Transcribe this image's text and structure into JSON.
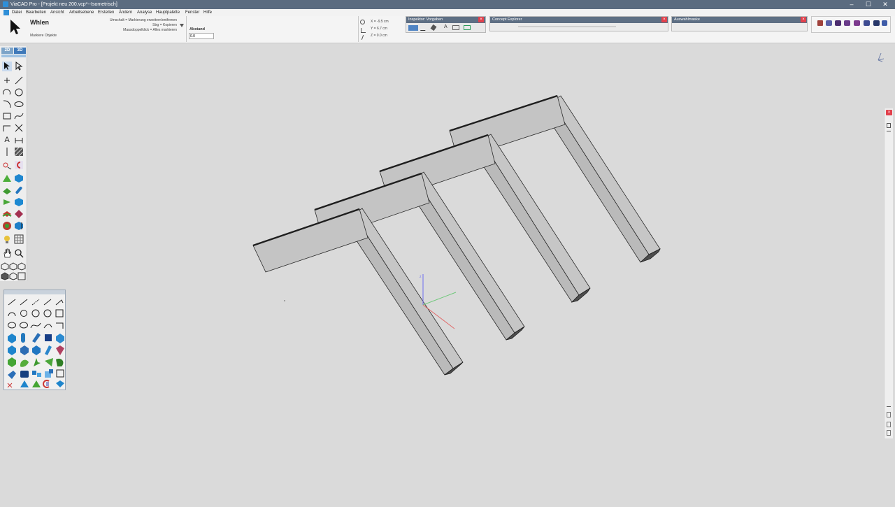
{
  "window": {
    "title": "ViaCAD Pro - [Projekt neu 200.vcp*--Isometrisch]",
    "controls": [
      "–",
      "☐",
      "✕"
    ]
  },
  "menu": [
    "Datei",
    "Bearbeiten",
    "Ansicht",
    "Arbeitsebene",
    "Erstellen",
    "Ändern",
    "Analyse",
    "Hauptpalette",
    "Fenster",
    "Hilfe"
  ],
  "controlbar": {
    "tool_name": "Whlen",
    "tool_hint": "Markiere Objekte",
    "modifiers": [
      "Umschalt = Markierung erweitern/entfernen",
      "Strg = Kopieren",
      "Mausdoppelklick = Alles markieren"
    ],
    "distance_label": "Abstand",
    "distance_value": "0.0",
    "coords": {
      "x": "X = -9.5 cm",
      "y": "Y = 6.7 cm",
      "z": "Z = 0.0 cm"
    }
  },
  "palettes": {
    "inspector": "Inspektor: Vorgaben",
    "concept": "Concept Explorer",
    "selection": "Auswahlmaske"
  },
  "left_toolbar": {
    "mode_2d": "2D",
    "mode_3d": "3D"
  },
  "colors": {
    "titlebar": "#5b6c80",
    "viewport": "#dadada",
    "beam_fill": "#c4c4c4",
    "beam_edge": "#2a2a2a",
    "close": "#e2414c"
  }
}
